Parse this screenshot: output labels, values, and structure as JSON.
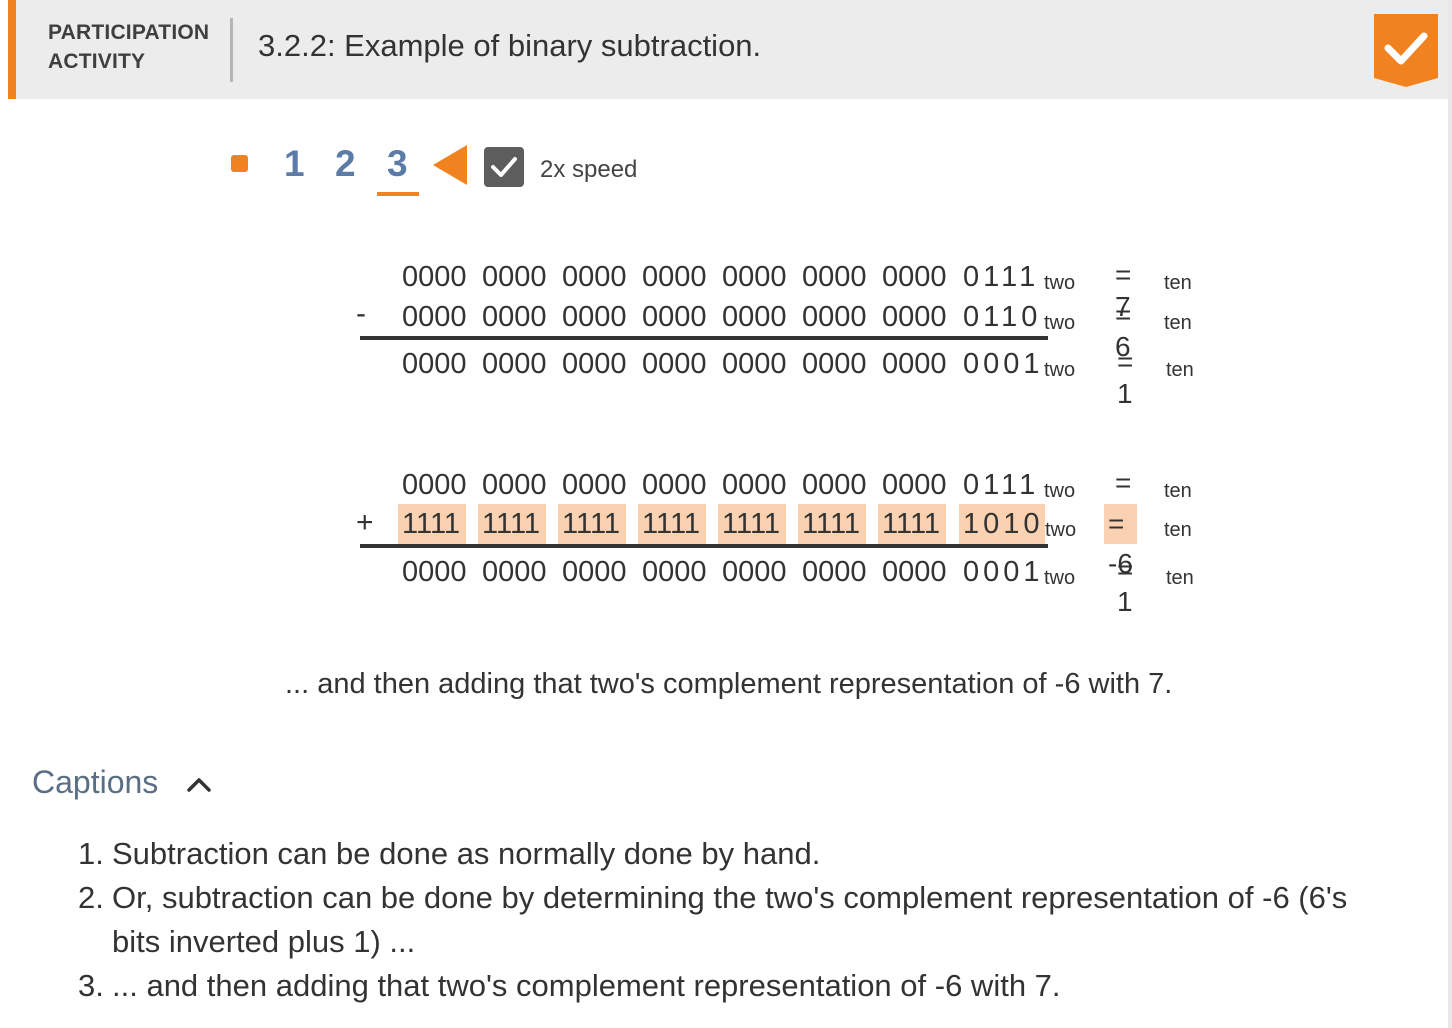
{
  "header": {
    "activity_line1": "PARTICIPATION",
    "activity_line2": "ACTIVITY",
    "title": "3.2.2: Example of binary subtraction.",
    "completed_icon": "checkmark-icon",
    "accent_color": "#f08220"
  },
  "controls": {
    "steps": [
      "1",
      "2",
      "3"
    ],
    "current_step": "3",
    "speed_label": "2x speed",
    "speed_checked": true
  },
  "subtraction": {
    "rows": [
      {
        "op": "",
        "groups": [
          "0000",
          "0000",
          "0000",
          "0000",
          "0000",
          "0000",
          "0000",
          "0111"
        ],
        "base": "two",
        "eq": "= 7",
        "eq_base": "ten"
      },
      {
        "op": "-",
        "groups": [
          "0000",
          "0000",
          "0000",
          "0000",
          "0000",
          "0000",
          "0000",
          "0110"
        ],
        "base": "two",
        "eq": "= 6",
        "eq_base": "ten"
      },
      {
        "op": "",
        "groups": [
          "0000",
          "0000",
          "0000",
          "0000",
          "0000",
          "0000",
          "0000",
          "0001"
        ],
        "base": "two",
        "eq": "= 1",
        "eq_base": "ten"
      }
    ]
  },
  "addition": {
    "rows": [
      {
        "op": "",
        "groups": [
          "0000",
          "0000",
          "0000",
          "0000",
          "0000",
          "0000",
          "0000",
          "0111"
        ],
        "base": "two",
        "eq": "= 7",
        "eq_base": "ten",
        "highlight": false
      },
      {
        "op": "+",
        "groups": [
          "1111",
          "1111",
          "1111",
          "1111",
          "1111",
          "1111",
          "1111",
          "1010"
        ],
        "base": "two",
        "eq": "= -6",
        "eq_base": "ten",
        "highlight": true
      },
      {
        "op": "",
        "groups": [
          "0000",
          "0000",
          "0000",
          "0000",
          "0000",
          "0000",
          "0000",
          "0001"
        ],
        "base": "two",
        "eq": "= 1",
        "eq_base": "ten",
        "highlight": false
      }
    ],
    "highlight_color": "#fad2b1"
  },
  "current_caption": "... and then adding that two's complement representation of -6 with 7.",
  "captions": {
    "heading": "Captions",
    "toggle_icon": "chevron-up-icon",
    "items": [
      {
        "num": "1.",
        "text": "Subtraction can be done as normally done by hand."
      },
      {
        "num": "2.",
        "text": "Or, subtraction can be done by determining the two's complement representation of -6 (6's bits inverted plus 1) ..."
      },
      {
        "num": "3.",
        "text": "... and then adding that two's complement representation of -6 with 7."
      }
    ]
  }
}
